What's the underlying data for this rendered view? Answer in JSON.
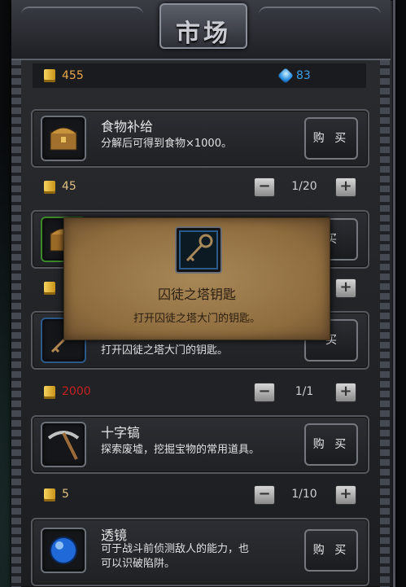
{
  "title": "市场",
  "currency": {
    "gold": "455",
    "gems": "83"
  },
  "items": [
    {
      "name": "食物补给",
      "desc": "分解后可得到食物×1000。",
      "buy": "购 买",
      "price": "45",
      "qty": "1/20",
      "icon": "treasure-chest-icon"
    },
    {
      "name": "",
      "desc": "",
      "buy": "买",
      "price": "",
      "qty": "",
      "icon": "chest-green-icon"
    },
    {
      "name": "",
      "desc": "打开囚徒之塔大门的钥匙。",
      "buy": "买",
      "price": "2000",
      "qty": "1/1",
      "icon": "key-icon"
    },
    {
      "name": "十字镐",
      "desc": "探索废墟，挖掘宝物的常用道具。",
      "buy": "购 买",
      "price": "5",
      "qty": "1/10",
      "icon": "pickaxe-icon"
    },
    {
      "name": "透镜",
      "desc": "可于战斗前侦测敌人的能力，也可以识破陷阱。",
      "desc_line1": "可于战斗前侦测敌人的能力，也",
      "desc_line2": "可以识破陷阱。",
      "buy": "购 买",
      "icon": "lens-icon"
    }
  ],
  "popup": {
    "name": "囚徒之塔钥匙",
    "desc": "打开囚徒之塔大门的钥匙。",
    "icon": "key-icon"
  },
  "stepper": {
    "minus": "−",
    "plus": "+"
  },
  "colors": {
    "gold": "#e9a64a",
    "gem": "#3a9de8",
    "price_red": "#c42020",
    "parchment": "#a88757"
  }
}
